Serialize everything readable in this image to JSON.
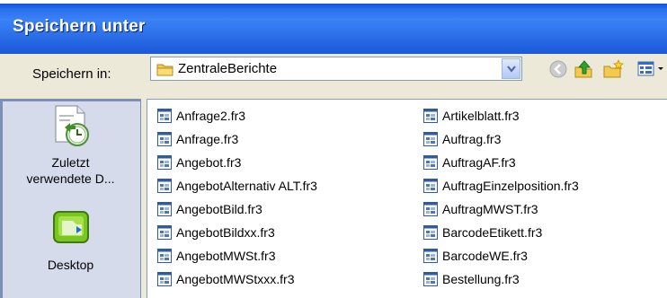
{
  "dialog": {
    "title": "Speichern unter"
  },
  "lookin": {
    "label": "Speichern in:",
    "value": "ZentraleBerichte"
  },
  "places": [
    {
      "label": "Zuletzt verwendete D..."
    },
    {
      "label": "Desktop"
    }
  ],
  "files_col1": [
    "Anfrage2.fr3",
    "Anfrage.fr3",
    "Angebot.fr3",
    "AngebotAlternativ ALT.fr3",
    "AngebotBild.fr3",
    "AngebotBildxx.fr3",
    "AngebotMWSt.fr3",
    "AngebotMWStxxx.fr3"
  ],
  "files_col2": [
    "Artikelblatt.fr3",
    "Auftrag.fr3",
    "AuftragAF.fr3",
    "AuftragEinzelposition.fr3",
    "AuftragMWST.fr3",
    "BarcodeEtikett.fr3",
    "BarcodeWE.fr3",
    "Bestellung.fr3"
  ],
  "colors": {
    "title_bar": "#2c6fe8",
    "dialog_bg": "#ece9d8",
    "places_bar": "#d5dbea",
    "file_icon": "#2f5aa8"
  }
}
